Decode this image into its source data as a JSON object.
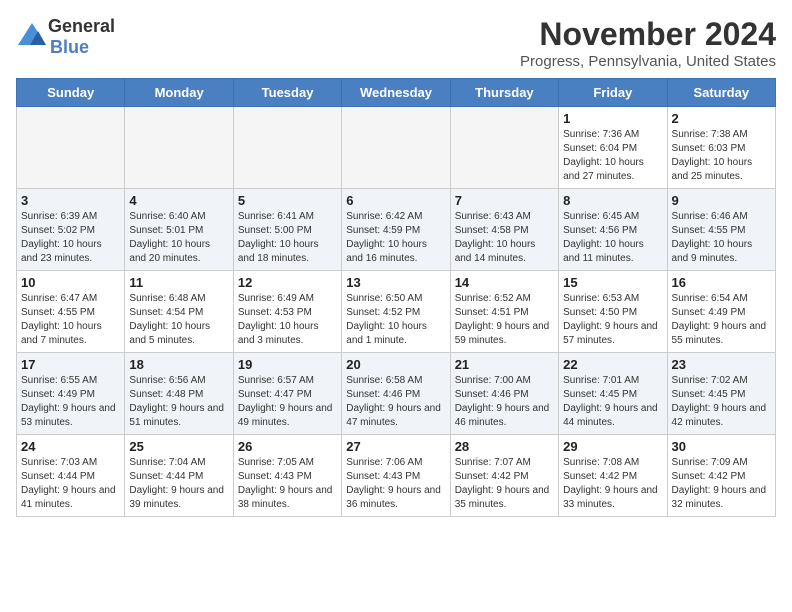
{
  "header": {
    "logo_general": "General",
    "logo_blue": "Blue",
    "month_title": "November 2024",
    "location": "Progress, Pennsylvania, United States"
  },
  "days_of_week": [
    "Sunday",
    "Monday",
    "Tuesday",
    "Wednesday",
    "Thursday",
    "Friday",
    "Saturday"
  ],
  "weeks": [
    [
      {
        "day": "",
        "info": ""
      },
      {
        "day": "",
        "info": ""
      },
      {
        "day": "",
        "info": ""
      },
      {
        "day": "",
        "info": ""
      },
      {
        "day": "",
        "info": ""
      },
      {
        "day": "1",
        "info": "Sunrise: 7:36 AM\nSunset: 6:04 PM\nDaylight: 10 hours and 27 minutes."
      },
      {
        "day": "2",
        "info": "Sunrise: 7:38 AM\nSunset: 6:03 PM\nDaylight: 10 hours and 25 minutes."
      }
    ],
    [
      {
        "day": "3",
        "info": "Sunrise: 6:39 AM\nSunset: 5:02 PM\nDaylight: 10 hours and 23 minutes."
      },
      {
        "day": "4",
        "info": "Sunrise: 6:40 AM\nSunset: 5:01 PM\nDaylight: 10 hours and 20 minutes."
      },
      {
        "day": "5",
        "info": "Sunrise: 6:41 AM\nSunset: 5:00 PM\nDaylight: 10 hours and 18 minutes."
      },
      {
        "day": "6",
        "info": "Sunrise: 6:42 AM\nSunset: 4:59 PM\nDaylight: 10 hours and 16 minutes."
      },
      {
        "day": "7",
        "info": "Sunrise: 6:43 AM\nSunset: 4:58 PM\nDaylight: 10 hours and 14 minutes."
      },
      {
        "day": "8",
        "info": "Sunrise: 6:45 AM\nSunset: 4:56 PM\nDaylight: 10 hours and 11 minutes."
      },
      {
        "day": "9",
        "info": "Sunrise: 6:46 AM\nSunset: 4:55 PM\nDaylight: 10 hours and 9 minutes."
      }
    ],
    [
      {
        "day": "10",
        "info": "Sunrise: 6:47 AM\nSunset: 4:55 PM\nDaylight: 10 hours and 7 minutes."
      },
      {
        "day": "11",
        "info": "Sunrise: 6:48 AM\nSunset: 4:54 PM\nDaylight: 10 hours and 5 minutes."
      },
      {
        "day": "12",
        "info": "Sunrise: 6:49 AM\nSunset: 4:53 PM\nDaylight: 10 hours and 3 minutes."
      },
      {
        "day": "13",
        "info": "Sunrise: 6:50 AM\nSunset: 4:52 PM\nDaylight: 10 hours and 1 minute."
      },
      {
        "day": "14",
        "info": "Sunrise: 6:52 AM\nSunset: 4:51 PM\nDaylight: 9 hours and 59 minutes."
      },
      {
        "day": "15",
        "info": "Sunrise: 6:53 AM\nSunset: 4:50 PM\nDaylight: 9 hours and 57 minutes."
      },
      {
        "day": "16",
        "info": "Sunrise: 6:54 AM\nSunset: 4:49 PM\nDaylight: 9 hours and 55 minutes."
      }
    ],
    [
      {
        "day": "17",
        "info": "Sunrise: 6:55 AM\nSunset: 4:49 PM\nDaylight: 9 hours and 53 minutes."
      },
      {
        "day": "18",
        "info": "Sunrise: 6:56 AM\nSunset: 4:48 PM\nDaylight: 9 hours and 51 minutes."
      },
      {
        "day": "19",
        "info": "Sunrise: 6:57 AM\nSunset: 4:47 PM\nDaylight: 9 hours and 49 minutes."
      },
      {
        "day": "20",
        "info": "Sunrise: 6:58 AM\nSunset: 4:46 PM\nDaylight: 9 hours and 47 minutes."
      },
      {
        "day": "21",
        "info": "Sunrise: 7:00 AM\nSunset: 4:46 PM\nDaylight: 9 hours and 46 minutes."
      },
      {
        "day": "22",
        "info": "Sunrise: 7:01 AM\nSunset: 4:45 PM\nDaylight: 9 hours and 44 minutes."
      },
      {
        "day": "23",
        "info": "Sunrise: 7:02 AM\nSunset: 4:45 PM\nDaylight: 9 hours and 42 minutes."
      }
    ],
    [
      {
        "day": "24",
        "info": "Sunrise: 7:03 AM\nSunset: 4:44 PM\nDaylight: 9 hours and 41 minutes."
      },
      {
        "day": "25",
        "info": "Sunrise: 7:04 AM\nSunset: 4:44 PM\nDaylight: 9 hours and 39 minutes."
      },
      {
        "day": "26",
        "info": "Sunrise: 7:05 AM\nSunset: 4:43 PM\nDaylight: 9 hours and 38 minutes."
      },
      {
        "day": "27",
        "info": "Sunrise: 7:06 AM\nSunset: 4:43 PM\nDaylight: 9 hours and 36 minutes."
      },
      {
        "day": "28",
        "info": "Sunrise: 7:07 AM\nSunset: 4:42 PM\nDaylight: 9 hours and 35 minutes."
      },
      {
        "day": "29",
        "info": "Sunrise: 7:08 AM\nSunset: 4:42 PM\nDaylight: 9 hours and 33 minutes."
      },
      {
        "day": "30",
        "info": "Sunrise: 7:09 AM\nSunset: 4:42 PM\nDaylight: 9 hours and 32 minutes."
      }
    ]
  ]
}
